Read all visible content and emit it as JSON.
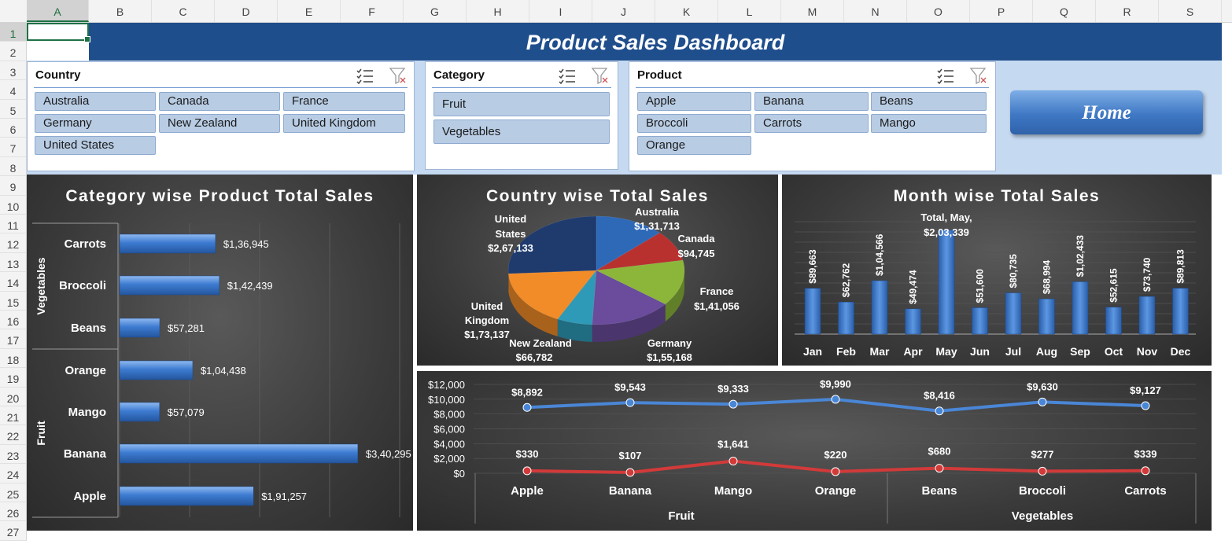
{
  "sheet": {
    "columns": [
      "A",
      "B",
      "C",
      "D",
      "E",
      "F",
      "G",
      "H",
      "I",
      "J",
      "K",
      "L",
      "M",
      "N",
      "O",
      "P",
      "Q",
      "R",
      "S"
    ],
    "rows": [
      "1",
      "2",
      "3",
      "4",
      "5",
      "6",
      "7",
      "8",
      "9",
      "10",
      "11",
      "12",
      "13",
      "14",
      "15",
      "16",
      "17",
      "18",
      "19",
      "20",
      "21",
      "22",
      "23",
      "24",
      "25",
      "26",
      "27"
    ],
    "selected_column": "A",
    "selected_row": "1"
  },
  "dashboard_title": "Product Sales Dashboard",
  "slicers": {
    "country": {
      "title": "Country",
      "items": [
        "Australia",
        "Canada",
        "France",
        "Germany",
        "New Zealand",
        "United Kingdom",
        "United States"
      ]
    },
    "category": {
      "title": "Category",
      "items": [
        "Fruit",
        "Vegetables"
      ]
    },
    "product": {
      "title": "Product",
      "items": [
        "Apple",
        "Banana",
        "Beans",
        "Broccoli",
        "Carrots",
        "Mango",
        "Orange"
      ]
    }
  },
  "home_button": "Home",
  "colors": {
    "banner": "#1f4e8c",
    "bar": "#3d7bd1",
    "line_blue": "#4a86d6",
    "line_red": "#d23a3a"
  },
  "chart_data": [
    {
      "type": "bar",
      "orientation": "horizontal",
      "title": "Category wise Product Total Sales",
      "groups": [
        {
          "name": "Vegetables",
          "categories": [
            "Carrots",
            "Broccoli",
            "Beans"
          ],
          "values": [
            136945,
            142439,
            57281
          ],
          "labels": [
            "$1,36,945",
            "$1,42,439",
            "$57,281"
          ]
        },
        {
          "name": "Fruit",
          "categories": [
            "Orange",
            "Mango",
            "Banana",
            "Apple"
          ],
          "values": [
            104438,
            57079,
            340295,
            191257
          ],
          "labels": [
            "$1,04,438",
            "$57,079",
            "$3,40,295",
            "$1,91,257"
          ]
        }
      ],
      "xlim": [
        0,
        400000
      ],
      "grid": true
    },
    {
      "type": "pie",
      "title": "Country wise Total Sales",
      "slices": [
        {
          "name": "Australia",
          "value": 131713,
          "label": "$1,31,713",
          "color": "#2e69b8"
        },
        {
          "name": "Canada",
          "value": 94745,
          "label": "$94,745",
          "color": "#b8312f"
        },
        {
          "name": "France",
          "value": 141056,
          "label": "$1,41,056",
          "color": "#8bb63a"
        },
        {
          "name": "Germany",
          "value": 155168,
          "label": "$1,55,168",
          "color": "#6a4b9c"
        },
        {
          "name": "New Zealand",
          "value": 66782,
          "label": "$66,782",
          "color": "#2e9ab8"
        },
        {
          "name": "United Kingdom",
          "value": 173137,
          "label": "$1,73,137",
          "color": "#f28c28"
        },
        {
          "name": "United States",
          "value": 267133,
          "label": "$2,67,133",
          "color": "#1f3b6e"
        }
      ]
    },
    {
      "type": "bar",
      "title": "Month wise Total Sales",
      "categories": [
        "Jan",
        "Feb",
        "Mar",
        "Apr",
        "May",
        "Jun",
        "Jul",
        "Aug",
        "Sep",
        "Oct",
        "Nov",
        "Dec"
      ],
      "values": [
        89663,
        62762,
        104566,
        49474,
        203339,
        51600,
        80735,
        68994,
        102433,
        52615,
        73740,
        89813
      ],
      "labels": [
        "$89,663",
        "$62,762",
        "$1,04,566",
        "$49,474",
        "$2,03,339",
        "$51,600",
        "$80,735",
        "$68,994",
        "$1,02,433",
        "$52,615",
        "$73,740",
        "$89,813"
      ],
      "callout": {
        "line1": "Total, May,",
        "line2": "$2,03,339"
      },
      "ylim": [
        0,
        220000
      ]
    },
    {
      "type": "line",
      "categories": [
        "Apple",
        "Banana",
        "Mango",
        "Orange",
        "Beans",
        "Broccoli",
        "Carrots"
      ],
      "groups": [
        {
          "name": "Fruit",
          "count": 4
        },
        {
          "name": "Vegetables",
          "count": 3
        }
      ],
      "series": [
        {
          "values": [
            8892,
            9543,
            9333,
            9990,
            8416,
            9630,
            9127
          ],
          "labels": [
            "$8,892",
            "$9,543",
            "$9,333",
            "$9,990",
            "$8,416",
            "$9,630",
            "$9,127"
          ],
          "color": "#4a86d6"
        },
        {
          "values": [
            330,
            107,
            1641,
            220,
            680,
            277,
            339
          ],
          "labels": [
            "$330",
            "$107",
            "$1,641",
            "$220",
            "$680",
            "$277",
            "$339"
          ],
          "color": "#d23a3a"
        }
      ],
      "yticks": [
        "$0",
        "$2,000",
        "$4,000",
        "$6,000",
        "$8,000",
        "$10,000",
        "$12,000"
      ],
      "ylim": [
        0,
        12000
      ],
      "grid": true
    }
  ]
}
